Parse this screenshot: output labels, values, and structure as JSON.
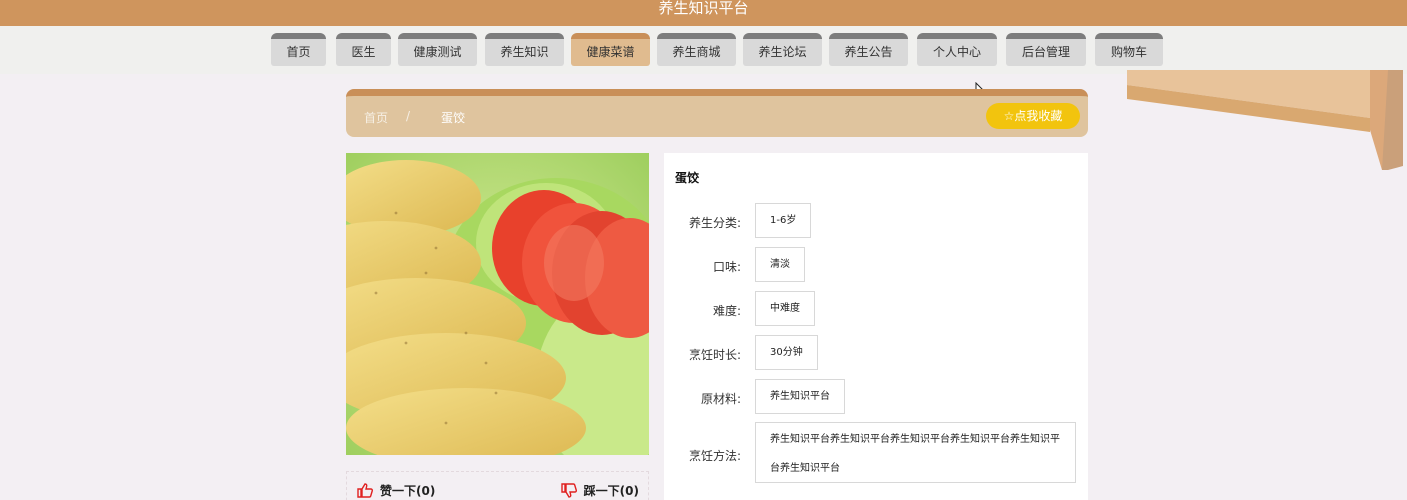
{
  "header": {
    "title": "养生知识平台"
  },
  "nav": [
    {
      "label": "首页",
      "name": "nav-item-home"
    },
    {
      "label": "医生",
      "name": "nav-item-doctor"
    },
    {
      "label": "健康测试",
      "name": "nav-item-health-test"
    },
    {
      "label": "养生知识",
      "name": "nav-item-health-knowledge"
    },
    {
      "label": "健康菜谱",
      "name": "nav-item-healthy-recipes"
    },
    {
      "label": "养生商城",
      "name": "nav-item-shop"
    },
    {
      "label": "养生论坛",
      "name": "nav-item-forum"
    },
    {
      "label": "养生公告",
      "name": "nav-item-announcements"
    },
    {
      "label": "个人中心",
      "name": "nav-item-personal-center"
    },
    {
      "label": "后台管理",
      "name": "nav-item-admin"
    },
    {
      "label": "购物车",
      "name": "nav-item-cart"
    }
  ],
  "nav_active_index": 4,
  "breadcrumb": {
    "home": "首页",
    "separator": "/",
    "current": "蛋饺"
  },
  "favorite_button": "点我收藏",
  "recipe": {
    "title": "蛋饺",
    "fields": [
      {
        "label": "养生分类:",
        "value": "1-6岁"
      },
      {
        "label": "口味:",
        "value": "清淡"
      },
      {
        "label": "难度:",
        "value": "中难度"
      },
      {
        "label": "烹饪时长:",
        "value": "30分钟"
      },
      {
        "label": "原材料:",
        "value": "养生知识平台"
      },
      {
        "label": "烹饪方法:",
        "value": "养生知识平台养生知识平台养生知识平台养生知识平台养生知识平台养生知识平台"
      }
    ]
  },
  "votes": {
    "like": "赞一下(0)",
    "dislike": "踩一下(0)"
  },
  "colors": {
    "primary": "#cf955d",
    "nav_active": "#e0bb8f",
    "favorite": "#f2c40e",
    "vote_icon": "#e02020"
  }
}
